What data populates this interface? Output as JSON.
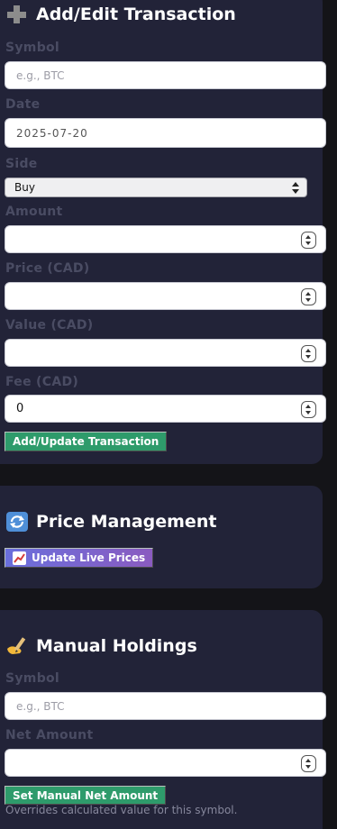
{
  "transaction": {
    "title": "Add/Edit Transaction",
    "symbol_label": "Symbol",
    "symbol_placeholder": "e.g., BTC",
    "date_label": "Date",
    "date_value": "2025-07-20",
    "side_label": "Side",
    "side_value": "Buy",
    "amount_label": "Amount",
    "price_label": "Price (CAD)",
    "value_label": "Value (CAD)",
    "fee_label": "Fee (CAD)",
    "fee_value": "0",
    "submit_label": "Add/Update Transaction"
  },
  "price_management": {
    "title": "Price Management",
    "update_label": "Update Live Prices"
  },
  "manual_holdings": {
    "title": "Manual Holdings",
    "symbol_label": "Symbol",
    "symbol_placeholder": "e.g., BTC",
    "net_amount_label": "Net Amount",
    "submit_label": "Set Manual Net Amount",
    "hint": "Overrides calculated value for this symbol."
  },
  "icons": {
    "transaction": "plus-icon",
    "price": "refresh-icon",
    "update": "chart-up-icon",
    "manual": "writing-hand-icon"
  },
  "colors": {
    "card_bg": "#222338",
    "page_bg": "#141418",
    "label": "#4a4c63",
    "green_button": "#2e9b6b",
    "purple_button": "#6a6fdc"
  }
}
